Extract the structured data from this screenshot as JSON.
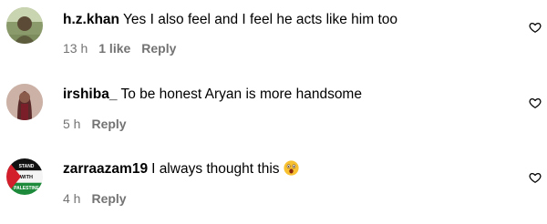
{
  "comments": [
    {
      "username": "h.z.khan",
      "text": "Yes I also feel and I feel he acts like him too",
      "time": "13 h",
      "likes": "1 like",
      "reply": "Reply",
      "avatar_icon": "user-avatar-icon",
      "like_icon": "heart-outline-icon"
    },
    {
      "username": "irshiba_",
      "text": "To be honest Aryan is more handsome",
      "time": "5 h",
      "reply": "Reply",
      "avatar_icon": "user-avatar-icon",
      "like_icon": "heart-outline-icon"
    },
    {
      "username": "zarraazam19",
      "text": "I always thought this",
      "emoji": "astonished-face-emoji",
      "avatar_text": [
        "STAND",
        "WITH",
        "PALESTINE"
      ],
      "time": "4 h",
      "reply": "Reply",
      "avatar_icon": "palestine-flag-avatar",
      "like_icon": "heart-outline-icon"
    }
  ],
  "colors": {
    "text": "#000000",
    "meta": "#737373",
    "background": "#ffffff"
  }
}
